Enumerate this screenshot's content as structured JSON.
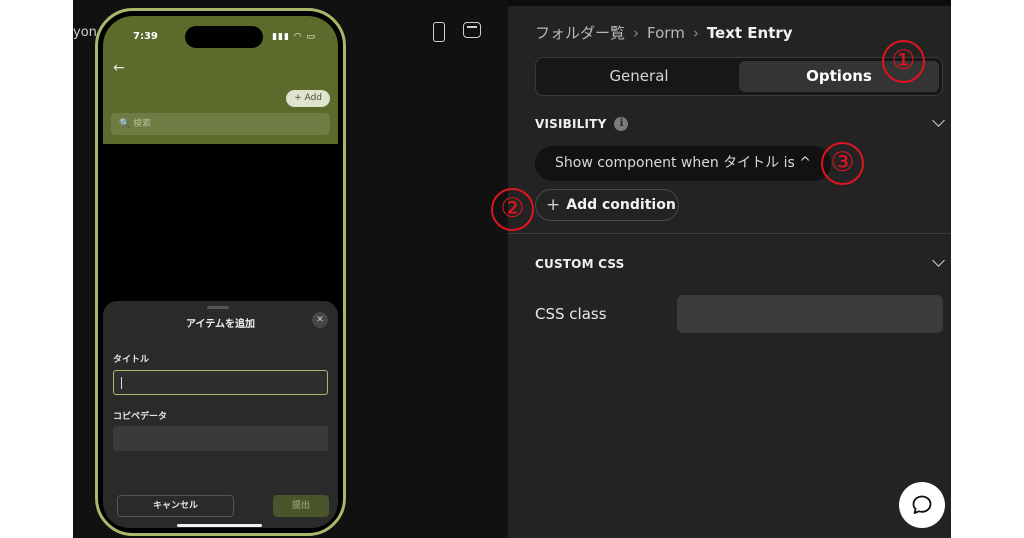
{
  "canvas": {
    "cut_text": "yon"
  },
  "phone": {
    "time": "7:39",
    "status_icons": "▮▮▮ ◠ ▭",
    "back": "←",
    "add_label": "+ Add",
    "search_placeholder": "🔍 検索",
    "sheet": {
      "title": "アイテムを追加",
      "close": "✕",
      "field1_label": "タイトル",
      "field2_label": "コピペデータ",
      "cancel_label": "キャンセル",
      "submit_label": "提出"
    }
  },
  "panel": {
    "breadcrumb": [
      "フォルダー覧",
      "Form",
      "Text Entry"
    ],
    "breadcrumb_sep": "›",
    "tabs": [
      {
        "label": "General",
        "active": false
      },
      {
        "label": "Options",
        "active": true
      }
    ],
    "visibility": {
      "title": "VISIBILITY",
      "info": "i",
      "condition": "Show component when タイトル is ^",
      "add_condition": "Add condition",
      "add_plus": "+"
    },
    "custom_css": {
      "title": "CUSTOM CSS",
      "field_label": "CSS class",
      "field_value": ""
    }
  },
  "annotations": [
    "①",
    "②",
    "③"
  ],
  "colors": {
    "accent_green": "#a9b86a",
    "header_green": "#5a6b2b",
    "annotation_red": "#e0141e",
    "panel_bg": "#232323"
  }
}
